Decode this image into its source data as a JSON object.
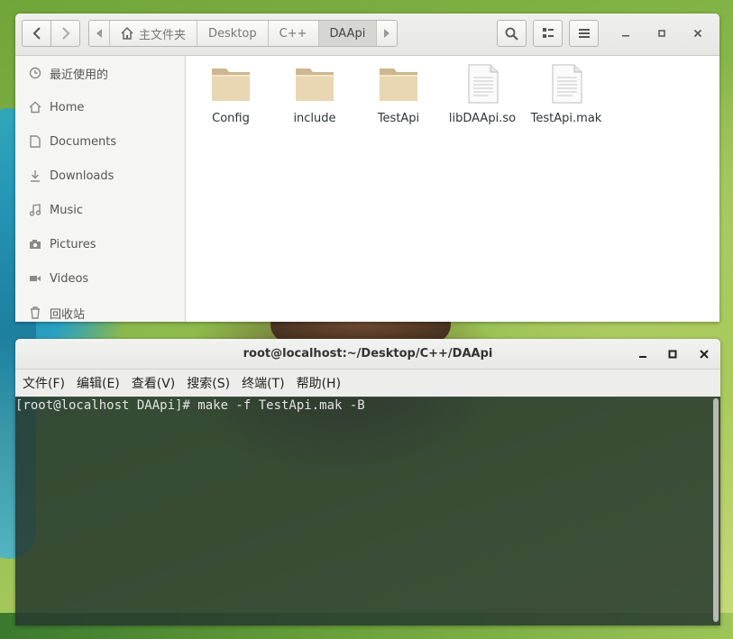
{
  "file_manager": {
    "path": [
      "主文件夹",
      "Desktop",
      "C++",
      "DAApi"
    ],
    "sidebar": [
      {
        "label": "最近使用的",
        "icon": "clock-icon"
      },
      {
        "label": "Home",
        "icon": "home-icon"
      },
      {
        "label": "Documents",
        "icon": "document-icon"
      },
      {
        "label": "Downloads",
        "icon": "download-icon"
      },
      {
        "label": "Music",
        "icon": "music-icon"
      },
      {
        "label": "Pictures",
        "icon": "camera-icon"
      },
      {
        "label": "Videos",
        "icon": "video-icon"
      },
      {
        "label": "回收站",
        "icon": "trash-icon"
      }
    ],
    "files": [
      {
        "name": "Config",
        "type": "folder"
      },
      {
        "name": "include",
        "type": "folder"
      },
      {
        "name": "TestApi",
        "type": "folder"
      },
      {
        "name": "libDAApi.so",
        "type": "file"
      },
      {
        "name": "TestApi.mak",
        "type": "file"
      }
    ]
  },
  "terminal": {
    "title": "root@localhost:~/Desktop/C++/DAApi",
    "menu": [
      "文件(F)",
      "编辑(E)",
      "查看(V)",
      "搜索(S)",
      "终端(T)",
      "帮助(H)"
    ],
    "lines": [
      "[root@localhost DAApi]# make -f TestApi.mak -B"
    ]
  },
  "colors": {
    "folder": "#e3cfa6",
    "terminal_bg": "#26382e",
    "accent": "#d6d6d3"
  }
}
